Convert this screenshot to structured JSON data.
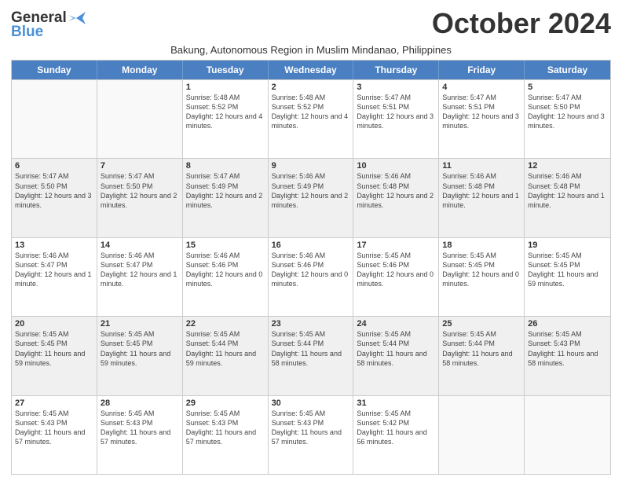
{
  "logo": {
    "line1": "General",
    "line2": "Blue",
    "tagline": "Blue"
  },
  "title": "October 2024",
  "location": "Bakung, Autonomous Region in Muslim Mindanao, Philippines",
  "header_days": [
    "Sunday",
    "Monday",
    "Tuesday",
    "Wednesday",
    "Thursday",
    "Friday",
    "Saturday"
  ],
  "weeks": [
    [
      {
        "day": "",
        "sunrise": "",
        "sunset": "",
        "daylight": "",
        "empty": true
      },
      {
        "day": "",
        "sunrise": "",
        "sunset": "",
        "daylight": "",
        "empty": true
      },
      {
        "day": "1",
        "sunrise": "Sunrise: 5:48 AM",
        "sunset": "Sunset: 5:52 PM",
        "daylight": "Daylight: 12 hours and 4 minutes."
      },
      {
        "day": "2",
        "sunrise": "Sunrise: 5:48 AM",
        "sunset": "Sunset: 5:52 PM",
        "daylight": "Daylight: 12 hours and 4 minutes."
      },
      {
        "day": "3",
        "sunrise": "Sunrise: 5:47 AM",
        "sunset": "Sunset: 5:51 PM",
        "daylight": "Daylight: 12 hours and 3 minutes."
      },
      {
        "day": "4",
        "sunrise": "Sunrise: 5:47 AM",
        "sunset": "Sunset: 5:51 PM",
        "daylight": "Daylight: 12 hours and 3 minutes."
      },
      {
        "day": "5",
        "sunrise": "Sunrise: 5:47 AM",
        "sunset": "Sunset: 5:50 PM",
        "daylight": "Daylight: 12 hours and 3 minutes."
      }
    ],
    [
      {
        "day": "6",
        "sunrise": "Sunrise: 5:47 AM",
        "sunset": "Sunset: 5:50 PM",
        "daylight": "Daylight: 12 hours and 3 minutes."
      },
      {
        "day": "7",
        "sunrise": "Sunrise: 5:47 AM",
        "sunset": "Sunset: 5:50 PM",
        "daylight": "Daylight: 12 hours and 2 minutes."
      },
      {
        "day": "8",
        "sunrise": "Sunrise: 5:47 AM",
        "sunset": "Sunset: 5:49 PM",
        "daylight": "Daylight: 12 hours and 2 minutes."
      },
      {
        "day": "9",
        "sunrise": "Sunrise: 5:46 AM",
        "sunset": "Sunset: 5:49 PM",
        "daylight": "Daylight: 12 hours and 2 minutes."
      },
      {
        "day": "10",
        "sunrise": "Sunrise: 5:46 AM",
        "sunset": "Sunset: 5:48 PM",
        "daylight": "Daylight: 12 hours and 2 minutes."
      },
      {
        "day": "11",
        "sunrise": "Sunrise: 5:46 AM",
        "sunset": "Sunset: 5:48 PM",
        "daylight": "Daylight: 12 hours and 1 minute."
      },
      {
        "day": "12",
        "sunrise": "Sunrise: 5:46 AM",
        "sunset": "Sunset: 5:48 PM",
        "daylight": "Daylight: 12 hours and 1 minute."
      }
    ],
    [
      {
        "day": "13",
        "sunrise": "Sunrise: 5:46 AM",
        "sunset": "Sunset: 5:47 PM",
        "daylight": "Daylight: 12 hours and 1 minute."
      },
      {
        "day": "14",
        "sunrise": "Sunrise: 5:46 AM",
        "sunset": "Sunset: 5:47 PM",
        "daylight": "Daylight: 12 hours and 1 minute."
      },
      {
        "day": "15",
        "sunrise": "Sunrise: 5:46 AM",
        "sunset": "Sunset: 5:46 PM",
        "daylight": "Daylight: 12 hours and 0 minutes."
      },
      {
        "day": "16",
        "sunrise": "Sunrise: 5:46 AM",
        "sunset": "Sunset: 5:46 PM",
        "daylight": "Daylight: 12 hours and 0 minutes."
      },
      {
        "day": "17",
        "sunrise": "Sunrise: 5:45 AM",
        "sunset": "Sunset: 5:46 PM",
        "daylight": "Daylight: 12 hours and 0 minutes."
      },
      {
        "day": "18",
        "sunrise": "Sunrise: 5:45 AM",
        "sunset": "Sunset: 5:45 PM",
        "daylight": "Daylight: 12 hours and 0 minutes."
      },
      {
        "day": "19",
        "sunrise": "Sunrise: 5:45 AM",
        "sunset": "Sunset: 5:45 PM",
        "daylight": "Daylight: 11 hours and 59 minutes."
      }
    ],
    [
      {
        "day": "20",
        "sunrise": "Sunrise: 5:45 AM",
        "sunset": "Sunset: 5:45 PM",
        "daylight": "Daylight: 11 hours and 59 minutes."
      },
      {
        "day": "21",
        "sunrise": "Sunrise: 5:45 AM",
        "sunset": "Sunset: 5:45 PM",
        "daylight": "Daylight: 11 hours and 59 minutes."
      },
      {
        "day": "22",
        "sunrise": "Sunrise: 5:45 AM",
        "sunset": "Sunset: 5:44 PM",
        "daylight": "Daylight: 11 hours and 59 minutes."
      },
      {
        "day": "23",
        "sunrise": "Sunrise: 5:45 AM",
        "sunset": "Sunset: 5:44 PM",
        "daylight": "Daylight: 11 hours and 58 minutes."
      },
      {
        "day": "24",
        "sunrise": "Sunrise: 5:45 AM",
        "sunset": "Sunset: 5:44 PM",
        "daylight": "Daylight: 11 hours and 58 minutes."
      },
      {
        "day": "25",
        "sunrise": "Sunrise: 5:45 AM",
        "sunset": "Sunset: 5:44 PM",
        "daylight": "Daylight: 11 hours and 58 minutes."
      },
      {
        "day": "26",
        "sunrise": "Sunrise: 5:45 AM",
        "sunset": "Sunset: 5:43 PM",
        "daylight": "Daylight: 11 hours and 58 minutes."
      }
    ],
    [
      {
        "day": "27",
        "sunrise": "Sunrise: 5:45 AM",
        "sunset": "Sunset: 5:43 PM",
        "daylight": "Daylight: 11 hours and 57 minutes."
      },
      {
        "day": "28",
        "sunrise": "Sunrise: 5:45 AM",
        "sunset": "Sunset: 5:43 PM",
        "daylight": "Daylight: 11 hours and 57 minutes."
      },
      {
        "day": "29",
        "sunrise": "Sunrise: 5:45 AM",
        "sunset": "Sunset: 5:43 PM",
        "daylight": "Daylight: 11 hours and 57 minutes."
      },
      {
        "day": "30",
        "sunrise": "Sunrise: 5:45 AM",
        "sunset": "Sunset: 5:43 PM",
        "daylight": "Daylight: 11 hours and 57 minutes."
      },
      {
        "day": "31",
        "sunrise": "Sunrise: 5:45 AM",
        "sunset": "Sunset: 5:42 PM",
        "daylight": "Daylight: 11 hours and 56 minutes."
      },
      {
        "day": "",
        "sunrise": "",
        "sunset": "",
        "daylight": "",
        "empty": true
      },
      {
        "day": "",
        "sunrise": "",
        "sunset": "",
        "daylight": "",
        "empty": true
      }
    ]
  ]
}
